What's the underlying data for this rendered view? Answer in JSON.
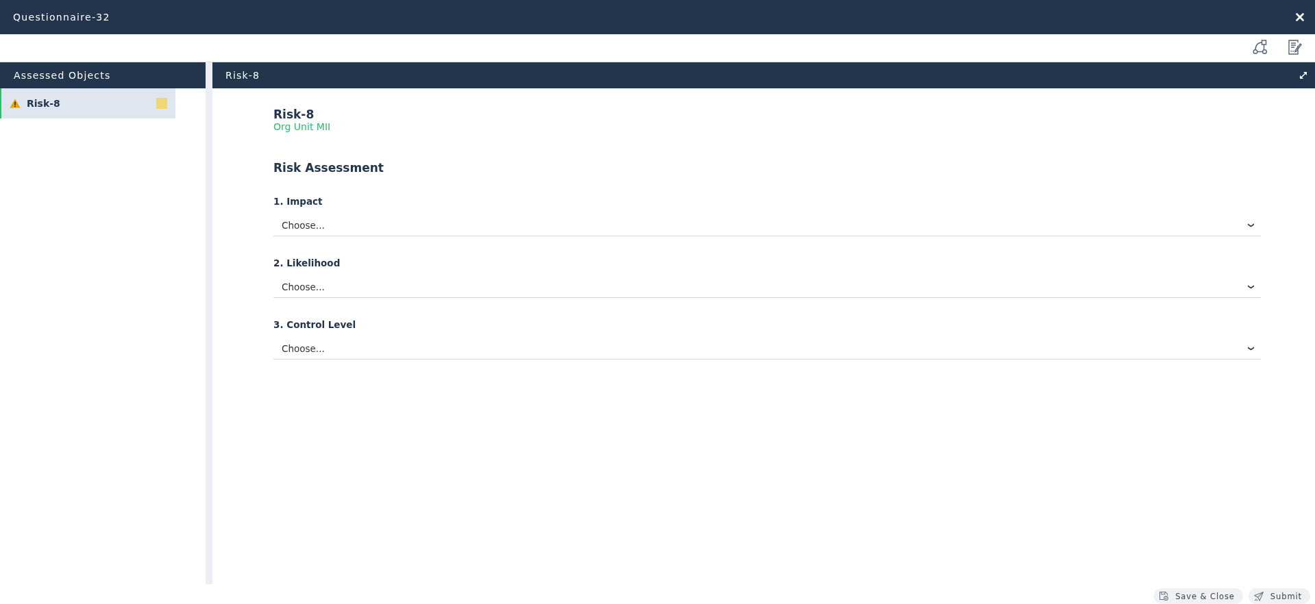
{
  "window": {
    "title": "Questionnaire-32"
  },
  "assessed_objects": {
    "title": "Assessed Objects",
    "items": [
      {
        "label": "Risk-8",
        "selected": true,
        "color": "#f0d675"
      }
    ]
  },
  "detail": {
    "header": "Risk-8",
    "object_title": "Risk-8",
    "org_unit": "Org Unit MII",
    "section_title": "Risk Assessment",
    "questions": [
      {
        "label": "1. Impact",
        "placeholder": "Choose..."
      },
      {
        "label": "2. Likelihood",
        "placeholder": "Choose..."
      },
      {
        "label": "3. Control Level",
        "placeholder": "Choose..."
      }
    ]
  },
  "footer": {
    "buttons": [
      {
        "kind": "save",
        "label": "Save & Close"
      },
      {
        "kind": "submit",
        "label": "Submit"
      }
    ]
  }
}
